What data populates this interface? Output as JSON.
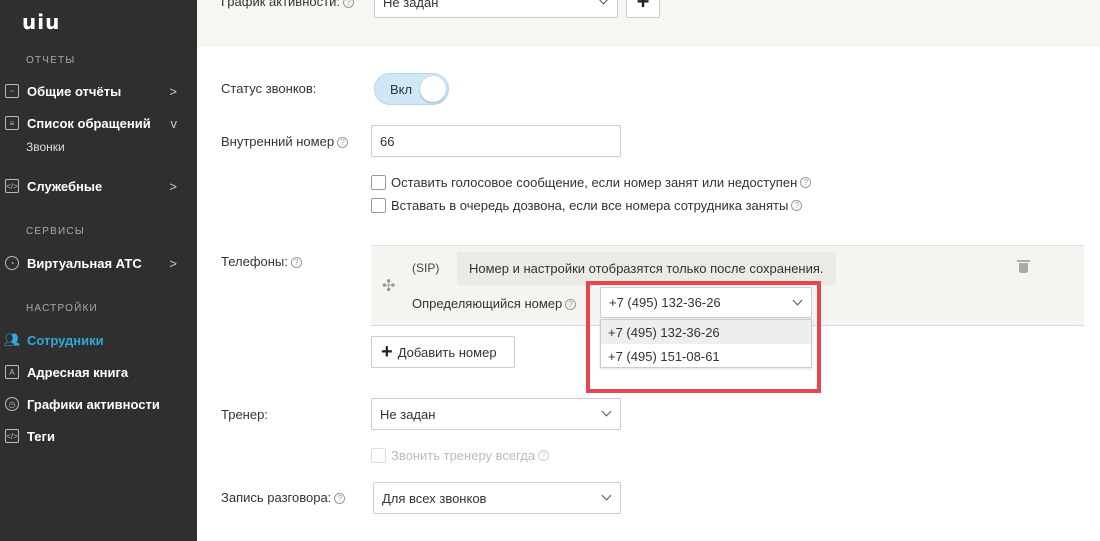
{
  "sidebar": {
    "logo": "uiu",
    "sections": {
      "reports": "ОТЧЕТЫ",
      "services": "СЕРВИСЫ",
      "settings": "НАСТРОЙКИ"
    },
    "items": {
      "general_reports": "Общие отчёты",
      "requests_list": "Список обращений",
      "calls": "Звонки",
      "service": "Служебные",
      "virtual_pbx": "Виртуальная АТС",
      "employees": "Сотрудники",
      "address_book": "Адресная книга",
      "activity_schedules": "Графики активности",
      "tags": "Теги"
    },
    "arrows": {
      "collapsed": ">",
      "expanded": "v"
    },
    "active_color": "#32a8d8"
  },
  "form": {
    "activity_schedule": {
      "label": "График активности:",
      "value": "Не задан"
    },
    "call_status": {
      "label": "Статус звонков:",
      "value": "Вкл"
    },
    "internal_number": {
      "label": "Внутренний номер",
      "value": "66"
    },
    "voicemail_checkbox": "Оставить голосовое сообщение, если номер занят или недоступен",
    "queue_checkbox": "Вставать в очередь дозвона, если все номера сотрудника заняты",
    "phones": {
      "label": "Телефоны:",
      "type": "(SIP)",
      "notice": "Номер и настройки отобразятся только после сохранения.",
      "caller_id_label": "Определяющийся номер",
      "caller_id_value": "+7 (495) 132-36-26",
      "options": [
        "+7 (495) 132-36-26",
        "+7 (495) 151-08-61"
      ]
    },
    "add_number_button": "Добавить номер",
    "trainer": {
      "label": "Тренер:",
      "value": "Не задан"
    },
    "call_trainer_checkbox": "Звонить тренеру всегда",
    "recording": {
      "label": "Запись разговора:",
      "value": "Для всех звонков"
    }
  },
  "help_glyph": "?",
  "plus_glyph": "+",
  "drag_glyph": "✣",
  "highlight_color": "#e8454f"
}
